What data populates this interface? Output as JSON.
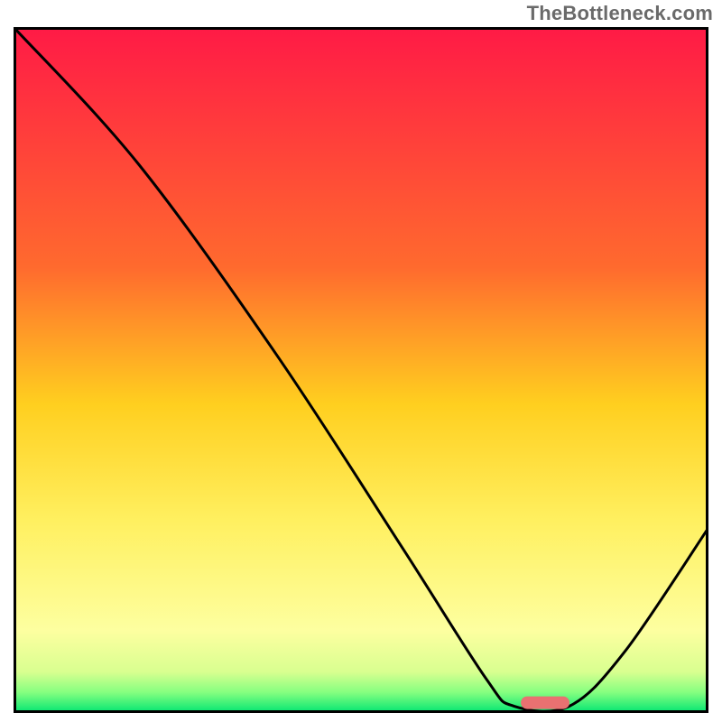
{
  "watermark": {
    "text": "TheBottleneck.com"
  },
  "chart_data": {
    "type": "line",
    "title": "",
    "xlabel": "",
    "ylabel": "",
    "xlim": [
      0,
      100
    ],
    "ylim": [
      0,
      100
    ],
    "grid": false,
    "legend": false,
    "gradient_stops": [
      {
        "offset": 0,
        "color": "#ff1a46"
      },
      {
        "offset": 0.35,
        "color": "#ff6a2e"
      },
      {
        "offset": 0.55,
        "color": "#ffcf1f"
      },
      {
        "offset": 0.72,
        "color": "#fff060"
      },
      {
        "offset": 0.88,
        "color": "#fdffa0"
      },
      {
        "offset": 0.94,
        "color": "#d9ff90"
      },
      {
        "offset": 0.97,
        "color": "#85ff80"
      },
      {
        "offset": 1.0,
        "color": "#00e572"
      }
    ],
    "curve": [
      {
        "x": 0,
        "y": 100
      },
      {
        "x": 18,
        "y": 80
      },
      {
        "x": 38,
        "y": 52
      },
      {
        "x": 56,
        "y": 24
      },
      {
        "x": 68,
        "y": 5
      },
      {
        "x": 72,
        "y": 1
      },
      {
        "x": 80,
        "y": 1
      },
      {
        "x": 88,
        "y": 9
      },
      {
        "x": 100,
        "y": 27
      }
    ],
    "optimal_marker": {
      "x_start": 73,
      "x_end": 80,
      "y": 1.5,
      "color": "#e97171"
    },
    "frame": {
      "stroke": "#000000",
      "stroke_width": 6
    }
  }
}
